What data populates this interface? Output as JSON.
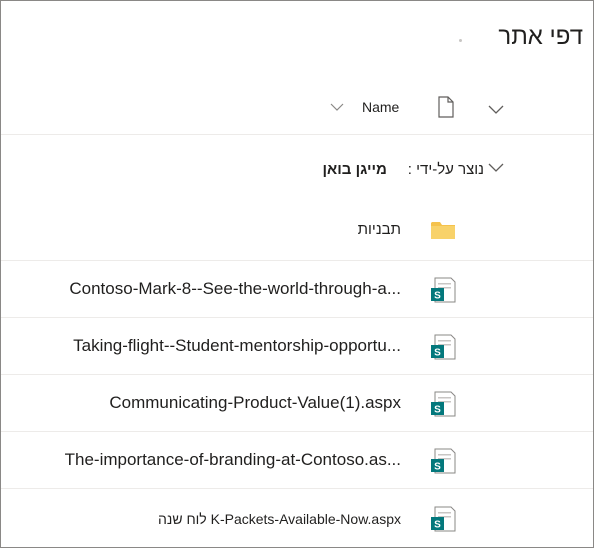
{
  "page": {
    "title": "דפי אתר"
  },
  "header": {
    "name_label": "Name"
  },
  "group": {
    "label": "נוצר על-ידי",
    "separator": " : ",
    "value": "מייגן בואן"
  },
  "folder": {
    "name": "תבניות",
    "icon": "folder-icon"
  },
  "files": [
    {
      "name": "Contoso-Mark-8--See-the-world-through-a..."
    },
    {
      "name": "Taking-flight--Student-mentorship-opportu..."
    },
    {
      "name": "Communicating-Product-Value(1).aspx"
    },
    {
      "name": "The-importance-of-branding-at-Contoso.as..."
    },
    {
      "name": "לוח שנה K-Packets-Available-Now.aspx"
    }
  ],
  "colors": {
    "folder": "#f5c24c",
    "folder_tab": "#e8a93a",
    "sharepoint_badge": "#03787c",
    "border": "#8a8886"
  }
}
